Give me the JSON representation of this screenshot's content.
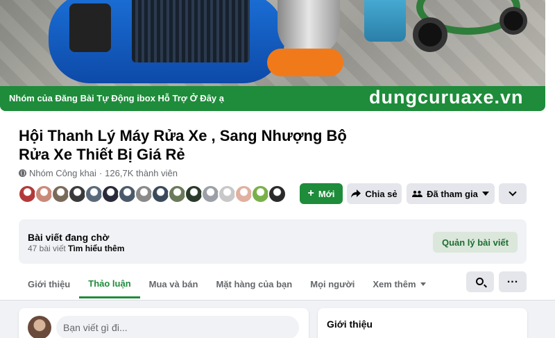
{
  "cover": {
    "banner_left": "Nhóm của Đăng Bài Tự Động ibox Hỗ Trợ Ở Đây ạ",
    "banner_right": "dungcuruaxe.vn",
    "accent": "#1e8c3a"
  },
  "group": {
    "title": "Hội Thanh Lý Máy Rửa Xe , Sang Nhượng Bộ Rửa Xe Thiết Bị Giá Rẻ",
    "privacy": "Nhóm Công khai",
    "separator": "·",
    "members": "126,7K thành viên"
  },
  "member_avatars": [
    {
      "color": "#b23a3a"
    },
    {
      "color": "#c98a7a"
    },
    {
      "color": "#7a6a5a"
    },
    {
      "color": "#3a3a3a"
    },
    {
      "color": "#5a6a7a"
    },
    {
      "color": "#2a2a3a"
    },
    {
      "color": "#4a5a6a"
    },
    {
      "color": "#8a8a8a"
    },
    {
      "color": "#3a4a5a"
    },
    {
      "color": "#6a7a5a"
    },
    {
      "color": "#2a3a2a"
    },
    {
      "color": "#9aa0a6"
    },
    {
      "color": "#c8c8c8"
    },
    {
      "color": "#e0b0a0"
    },
    {
      "color": "#7ab04a"
    },
    {
      "color": "#2a2a2a"
    }
  ],
  "actions": {
    "new_label": "Mới",
    "share_label": "Chia sẻ",
    "joined_label": "Đã tham gia"
  },
  "pending": {
    "title": "Bài viết đang chờ",
    "count": "47 bài viết",
    "learn_more": "Tìm hiểu thêm",
    "manage_label": "Quản lý bài viết"
  },
  "tabs": [
    {
      "label": "Giới thiệu",
      "active": false
    },
    {
      "label": "Thảo luận",
      "active": true
    },
    {
      "label": "Mua và bán",
      "active": false
    },
    {
      "label": "Mặt hàng của bạn",
      "active": false
    },
    {
      "label": "Mọi người",
      "active": false
    },
    {
      "label": "Xem thêm",
      "active": false
    }
  ],
  "composer": {
    "placeholder": "Bạn viết gì đi..."
  },
  "about": {
    "title": "Giới thiệu"
  }
}
